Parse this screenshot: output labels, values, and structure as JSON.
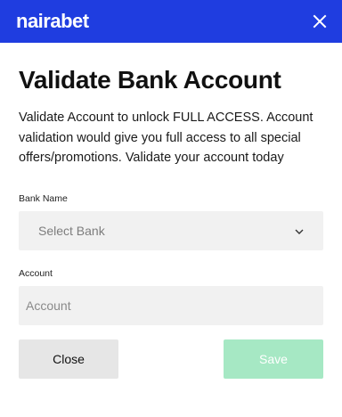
{
  "header": {
    "logo_text": "nairabet",
    "background_color": "#1f3de0",
    "close_icon": "close-icon"
  },
  "dialog": {
    "title": "Validate Bank Account",
    "description": "Validate Account to unlock FULL ACCESS. Account validation would give you full access to all special offers/promotions. Validate your account today"
  },
  "form": {
    "bank": {
      "label": "Bank Name",
      "selected": "Select Bank",
      "icon": "chevron-down-icon"
    },
    "account": {
      "label": "Account",
      "placeholder": "Account",
      "value": ""
    }
  },
  "actions": {
    "close_label": "Close",
    "save_label": "Save",
    "save_color": "#a6e8c4"
  }
}
